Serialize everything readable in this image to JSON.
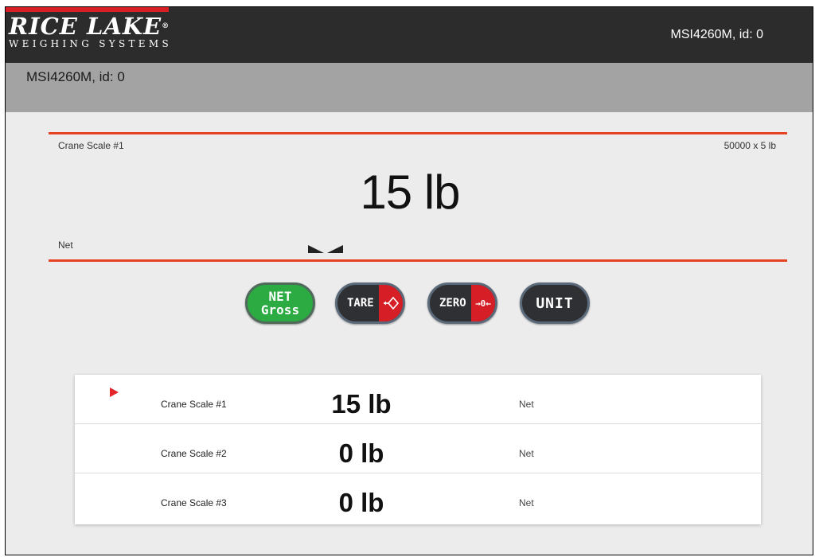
{
  "header": {
    "logo_main": "RICE LAKE",
    "logo_reg": "®",
    "logo_sub": "WEIGHING SYSTEMS",
    "device": "MSI4260M, id: 0"
  },
  "subheader": {
    "title": "MSI4260M, id: 0"
  },
  "scale_display": {
    "name": "Crane Scale #1",
    "capacity": "50000 x 5 lb",
    "weight": "15 lb",
    "mode": "Net"
  },
  "buttons": {
    "net_top": "NET",
    "net_bottom": "Gross",
    "tare": "TARE",
    "zero": "ZERO",
    "unit": "UNIT"
  },
  "scale_list": [
    {
      "name": "Crane Scale #1",
      "weight": "15 lb",
      "mode": "Net",
      "selected": true
    },
    {
      "name": "Crane Scale #2",
      "weight": "0 lb",
      "mode": "Net",
      "selected": false
    },
    {
      "name": "Crane Scale #3",
      "weight": "0 lb",
      "mode": "Net",
      "selected": false
    }
  ],
  "colors": {
    "accent_red": "#e54224",
    "net_green": "#2cab43",
    "topbar": "#2c2c2c"
  }
}
